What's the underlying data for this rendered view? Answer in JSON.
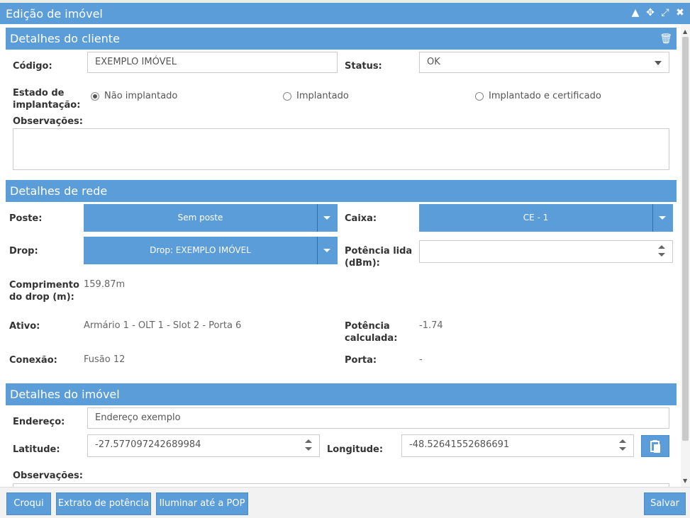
{
  "window": {
    "title": "Edição de imóvel"
  },
  "client_section": {
    "title": "Detalhes do cliente",
    "codigo_label": "Código:",
    "codigo_value": "EXEMPLO IMÓVEL",
    "status_label": "Status:",
    "status_value": "OK",
    "estado_label_1": "Estado de",
    "estado_label_2": "implantação:",
    "radio_options": [
      "Não implantado",
      "Implantado",
      "Implantado e certificado"
    ],
    "radio_selected": "Não implantado",
    "observacoes_label": "Observações:"
  },
  "network_section": {
    "title": "Detalhes de rede",
    "poste_label": "Poste:",
    "poste_value": "Sem poste",
    "caixa_label": "Caixa:",
    "caixa_value": "CE - 1",
    "drop_label": "Drop:",
    "drop_value": "Drop: EXEMPLO IMÓVEL",
    "potencia_lida_label_1": "Potência lida",
    "potencia_lida_label_2": "(dBm):",
    "comprimento_label_1": "Comprimento",
    "comprimento_label_2": "do drop (m):",
    "comprimento_value": "159.87m",
    "ativo_label": "Ativo:",
    "ativo_value": "Armário 1 - OLT 1 - Slot 2 - Porta 6",
    "potencia_calc_label_1": "Potência",
    "potencia_calc_label_2": "calculada:",
    "potencia_calc_value": "-1.74",
    "conexao_label": "Conexão:",
    "conexao_value": "Fusão 12",
    "porta_label": "Porta:",
    "porta_value": "-"
  },
  "property_section": {
    "title": "Detalhes do imóvel",
    "endereco_label": "Endereço:",
    "endereco_value": "Endereço exemplo",
    "latitude_label": "Latitude:",
    "latitude_value": "-27.577097242689984",
    "longitude_label": "Longitude:",
    "longitude_value": "-48.52641552686691",
    "observacoes_label": "Observações:"
  },
  "footer": {
    "croqui": "Croqui",
    "extrato": "Extrato de potência",
    "iluminar": "Iluminar até a POP",
    "salvar": "Salvar"
  },
  "colors": {
    "accent": "#5b9dd9"
  }
}
